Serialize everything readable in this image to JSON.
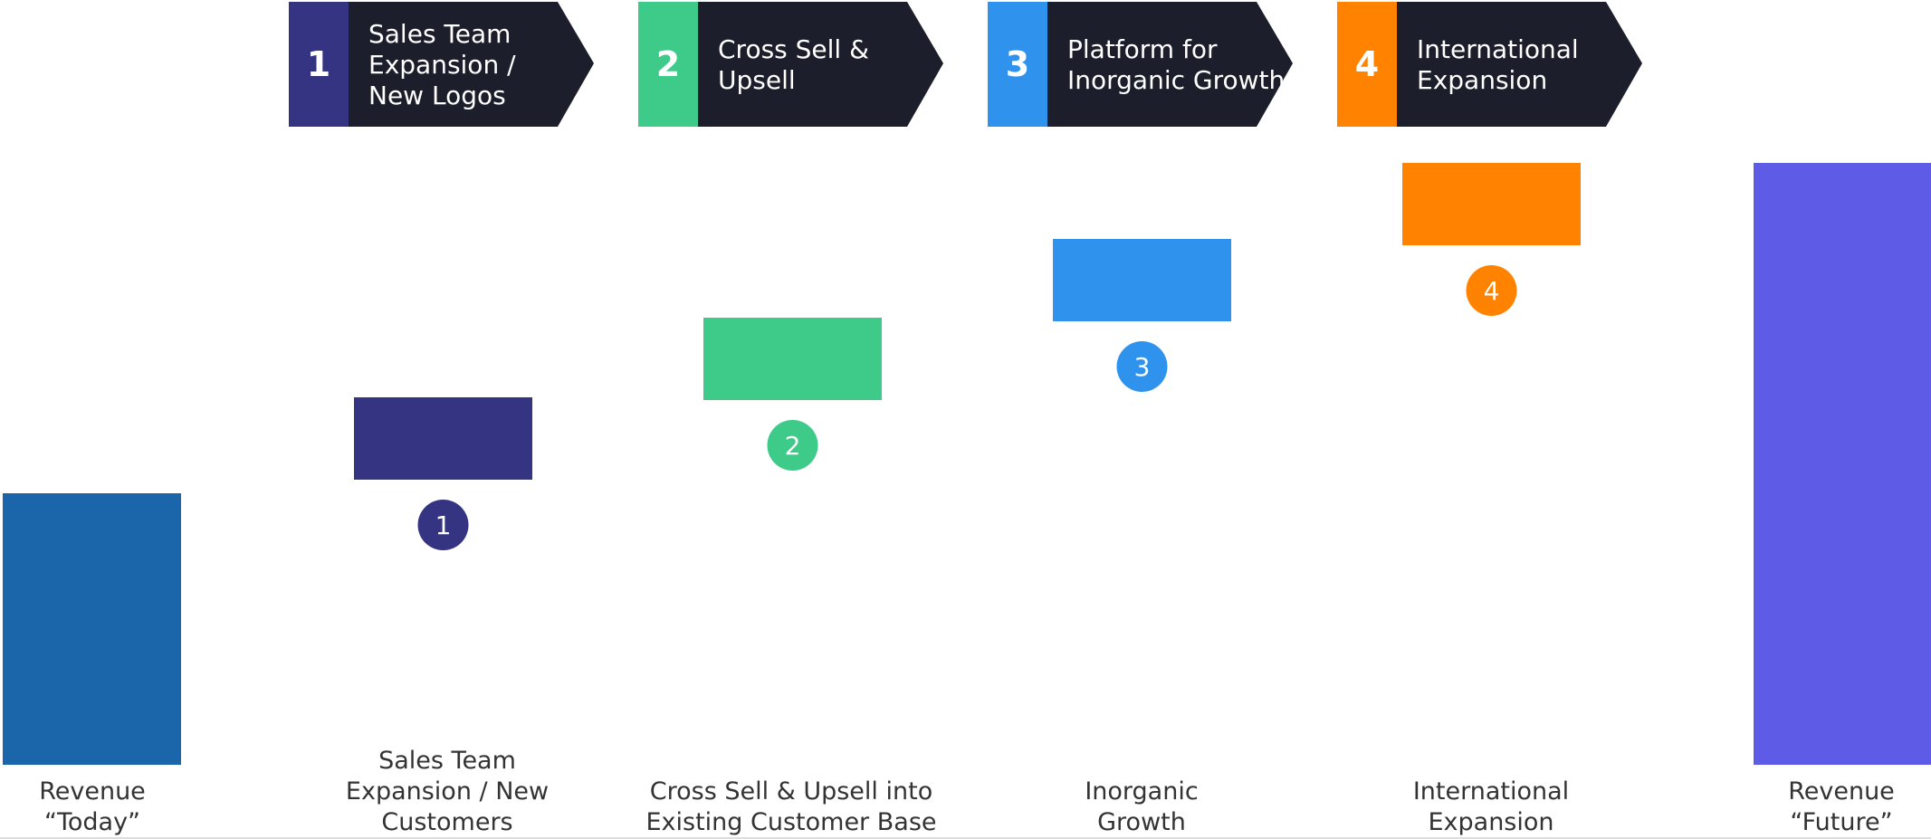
{
  "chart_data": {
    "type": "bar",
    "subtype": "waterfall",
    "grid": false,
    "legend": "none",
    "colors": {
      "header_body": "#1c1f2b",
      "baseline": "#bbbbbb",
      "label_text": "#333333"
    },
    "headers": [
      {
        "number": "1",
        "lines": [
          "Sales Team",
          "Expansion /",
          "New Logos"
        ],
        "color": "#343483"
      },
      {
        "number": "2",
        "lines": [
          "Cross Sell &",
          "Upsell"
        ],
        "color": "#3ecb89"
      },
      {
        "number": "3",
        "lines": [
          "Platform for",
          "Inorganic Growth"
        ],
        "color": "#2f93ee"
      },
      {
        "number": "4",
        "lines": [
          "International",
          "Expansion"
        ],
        "color": "#ff8300"
      }
    ],
    "categories": [
      {
        "lines": [
          "Revenue",
          "“Today”"
        ]
      },
      {
        "lines": [
          "Sales Team",
          "Expansion / New",
          "Customers"
        ]
      },
      {
        "lines": [
          "Cross Sell & Upsell into",
          "Existing Customer Base"
        ]
      },
      {
        "lines": [
          "Inorganic",
          "Growth"
        ]
      },
      {
        "lines": [
          "International",
          "Expansion"
        ]
      },
      {
        "lines": [
          "Revenue",
          "“Future”"
        ]
      }
    ],
    "bars": [
      {
        "kind": "total",
        "base": 0,
        "value": 30,
        "color": "#1b65aa"
      },
      {
        "kind": "increment",
        "base": 31.5,
        "value": 9.1,
        "color": "#343483",
        "marker": "1"
      },
      {
        "kind": "increment",
        "base": 40.3,
        "value": 9.1,
        "color": "#3ecb89",
        "marker": "2"
      },
      {
        "kind": "increment",
        "base": 49.0,
        "value": 9.1,
        "color": "#2f93ee",
        "marker": "3"
      },
      {
        "kind": "increment",
        "base": 57.4,
        "value": 9.1,
        "color": "#ff8300",
        "marker": "4"
      },
      {
        "kind": "total",
        "base": 0,
        "value": 66.5,
        "color": "#5e5ce6"
      }
    ],
    "ylim": [
      0,
      66.5
    ]
  }
}
